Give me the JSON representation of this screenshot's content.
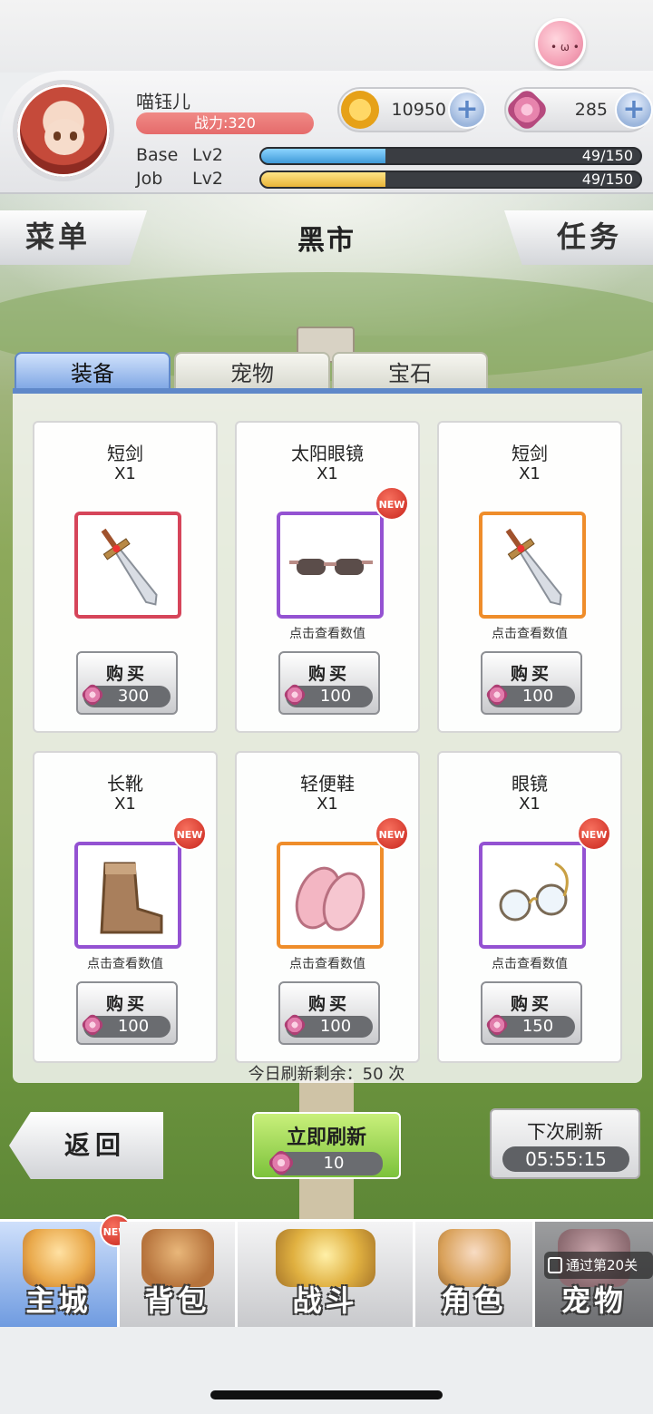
{
  "header": {
    "player_name": "喵钰儿",
    "power": "战力:320",
    "coins": "10950",
    "gems": "285",
    "base_label": "Base",
    "base_level": "Lv2",
    "base_xp": "49/150",
    "base_progress": 0.327,
    "job_label": "Job",
    "job_level": "Lv2",
    "job_xp": "49/150",
    "job_progress": 0.327
  },
  "menu": {
    "left": "菜单",
    "title": "黑市",
    "right": "任务"
  },
  "tabs": [
    {
      "label": "装备",
      "active": true
    },
    {
      "label": "宠物",
      "active": false
    },
    {
      "label": "宝石",
      "active": false
    }
  ],
  "items": [
    {
      "name": "短剑",
      "qty": "X1",
      "buy": "购买",
      "price": "300",
      "hint": "",
      "frame": "red",
      "new": false,
      "icon": "short-sword-icon"
    },
    {
      "name": "太阳眼镜",
      "qty": "X1",
      "buy": "购买",
      "price": "100",
      "hint": "点击查看数值",
      "frame": "purple",
      "new": true,
      "icon": "sunglasses-icon"
    },
    {
      "name": "短剑",
      "qty": "X1",
      "buy": "购买",
      "price": "100",
      "hint": "点击查看数值",
      "frame": "orange",
      "new": false,
      "icon": "short-sword-icon"
    },
    {
      "name": "长靴",
      "qty": "X1",
      "buy": "购买",
      "price": "100",
      "hint": "点击查看数值",
      "frame": "purple",
      "new": true,
      "icon": "long-boots-icon"
    },
    {
      "name": "轻便鞋",
      "qty": "X1",
      "buy": "购买",
      "price": "100",
      "hint": "点击查看数值",
      "frame": "orange",
      "new": true,
      "icon": "light-shoes-icon"
    },
    {
      "name": "眼镜",
      "qty": "X1",
      "buy": "购买",
      "price": "150",
      "hint": "点击查看数值",
      "frame": "purple",
      "new": true,
      "icon": "glasses-icon"
    }
  ],
  "new_badge": "NEW",
  "refresh_left": "今日刷新剩余：50 次",
  "footer": {
    "back": "返回",
    "refresh_now": "立即刷新",
    "refresh_price": "10",
    "next_refresh": "下次刷新",
    "timer": "05:55:15"
  },
  "nav": [
    {
      "label": "主城",
      "active": true,
      "new": true,
      "icon": "castle-icon"
    },
    {
      "label": "背包",
      "active": false,
      "new": false,
      "icon": "backpack-icon"
    },
    {
      "label": "战斗",
      "active": false,
      "new": false,
      "icon": "battle-icon"
    },
    {
      "label": "角色",
      "active": false,
      "new": false,
      "icon": "character-icon"
    },
    {
      "label": "宠物",
      "active": false,
      "new": false,
      "locked": true,
      "icon": "pet-icon"
    }
  ],
  "lock_note": "通过第20关",
  "colors": {
    "frame_red": "#d6455a",
    "frame_purple": "#9452d2",
    "frame_orange": "#ef8d2b",
    "tab_active": "#7ea6e4",
    "refresh_green": "#7cc23b"
  }
}
